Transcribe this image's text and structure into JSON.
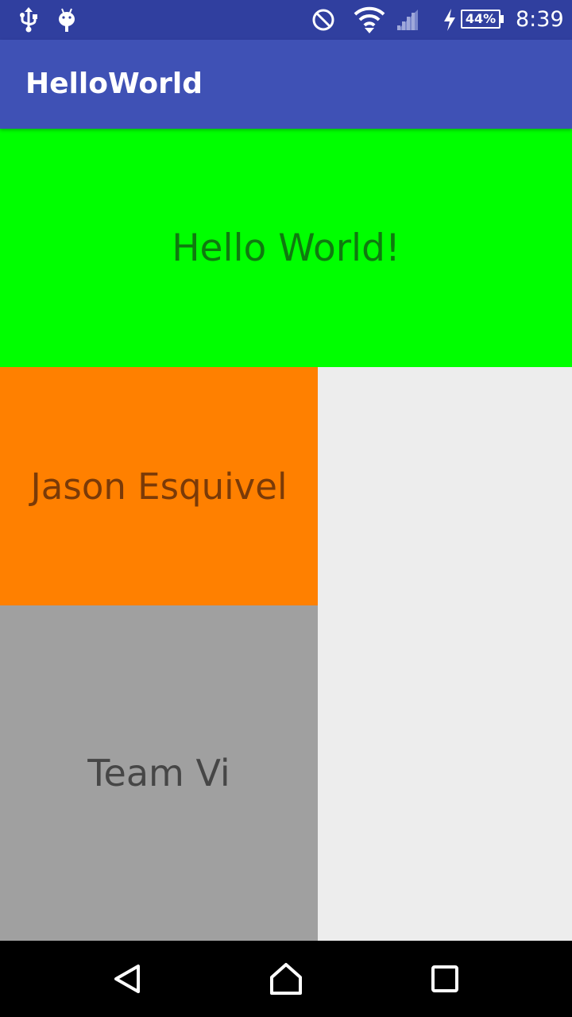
{
  "status_bar": {
    "icons": [
      "usb-icon",
      "android-debug-icon",
      "do-not-disturb-icon",
      "wifi-icon",
      "cell-signal-icon",
      "charging-icon"
    ],
    "battery": "44%",
    "time": "8:39"
  },
  "app_bar": {
    "title": "HelloWorld"
  },
  "content": {
    "hello_text": "Hello World!",
    "name_text": "Jason Esquivel",
    "team_text": "Team Vi"
  },
  "colors": {
    "status_bar": "#303f9f",
    "app_bar": "#3f51b5",
    "hello_panel": "#00ff00",
    "name_panel": "#ff8000",
    "team_panel": "#a0a0a0",
    "background": "#ededed"
  },
  "nav_bar": {
    "buttons": [
      "back-icon",
      "home-icon",
      "recents-icon"
    ]
  }
}
